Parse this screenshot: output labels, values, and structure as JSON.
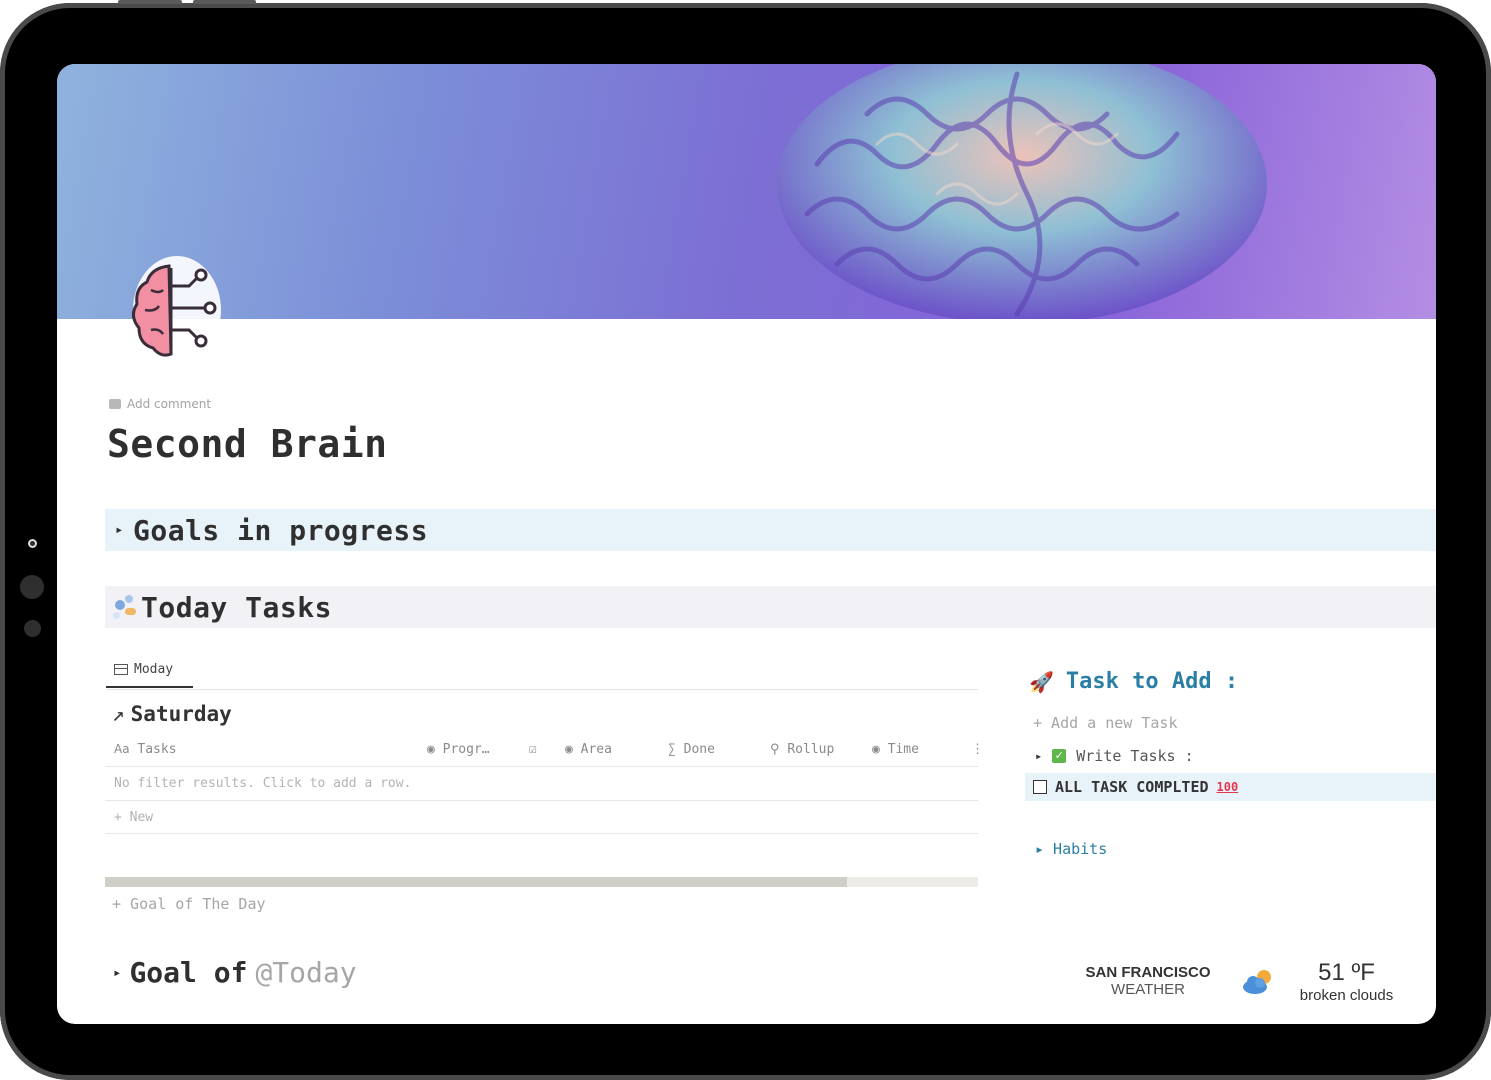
{
  "page": {
    "add_comment": "Add comment",
    "title": "Second Brain"
  },
  "goals_section": {
    "caret": "▸",
    "title": "Goals in progress"
  },
  "today_section": {
    "title": "Today Tasks"
  },
  "view_tab": {
    "label": "Moday"
  },
  "group": {
    "arrow": "↗",
    "title": "Saturday"
  },
  "table": {
    "columns": [
      {
        "icon": "Aa",
        "label": "Tasks"
      },
      {
        "icon": "◉",
        "label": "Progr…"
      },
      {
        "icon": "☑",
        "label": ""
      },
      {
        "icon": "◉",
        "label": "Area"
      },
      {
        "icon": "∑",
        "label": "Done"
      },
      {
        "icon": "⚲",
        "label": "Rollup"
      },
      {
        "icon": "◉",
        "label": "Time"
      },
      {
        "icon": "⋮",
        "label": ""
      }
    ],
    "empty_message": "No filter results. Click to add a row.",
    "new_row": "+ New"
  },
  "progress": {
    "value": 0.85
  },
  "goal_of_the_day": "+ Goal of The Day",
  "goal_today": {
    "caret": "▸",
    "prefix": "Goal of",
    "mention": "@Today"
  },
  "task_panel": {
    "rocket": "🚀",
    "title": "Task to Add :",
    "add_new": "+ Add a new Task",
    "write_caret": "▸",
    "write_check": "✓",
    "write_label": "Write Tasks :",
    "all_done_label": "ALL TASK COMPLTED",
    "all_done_emoji": "100",
    "habits": "▸ Habits"
  },
  "weather": {
    "city": "SAN FRANCISCO",
    "label": "WEATHER",
    "temp": "51 ºF",
    "description": "broken clouds",
    "icon": "cloud-sun-icon"
  },
  "colors": {
    "accent_blue": "#2b7fa6",
    "goals_band": "#e8f2f9",
    "today_band": "#f2f1f5",
    "checkbox_green": "#5fb649"
  }
}
